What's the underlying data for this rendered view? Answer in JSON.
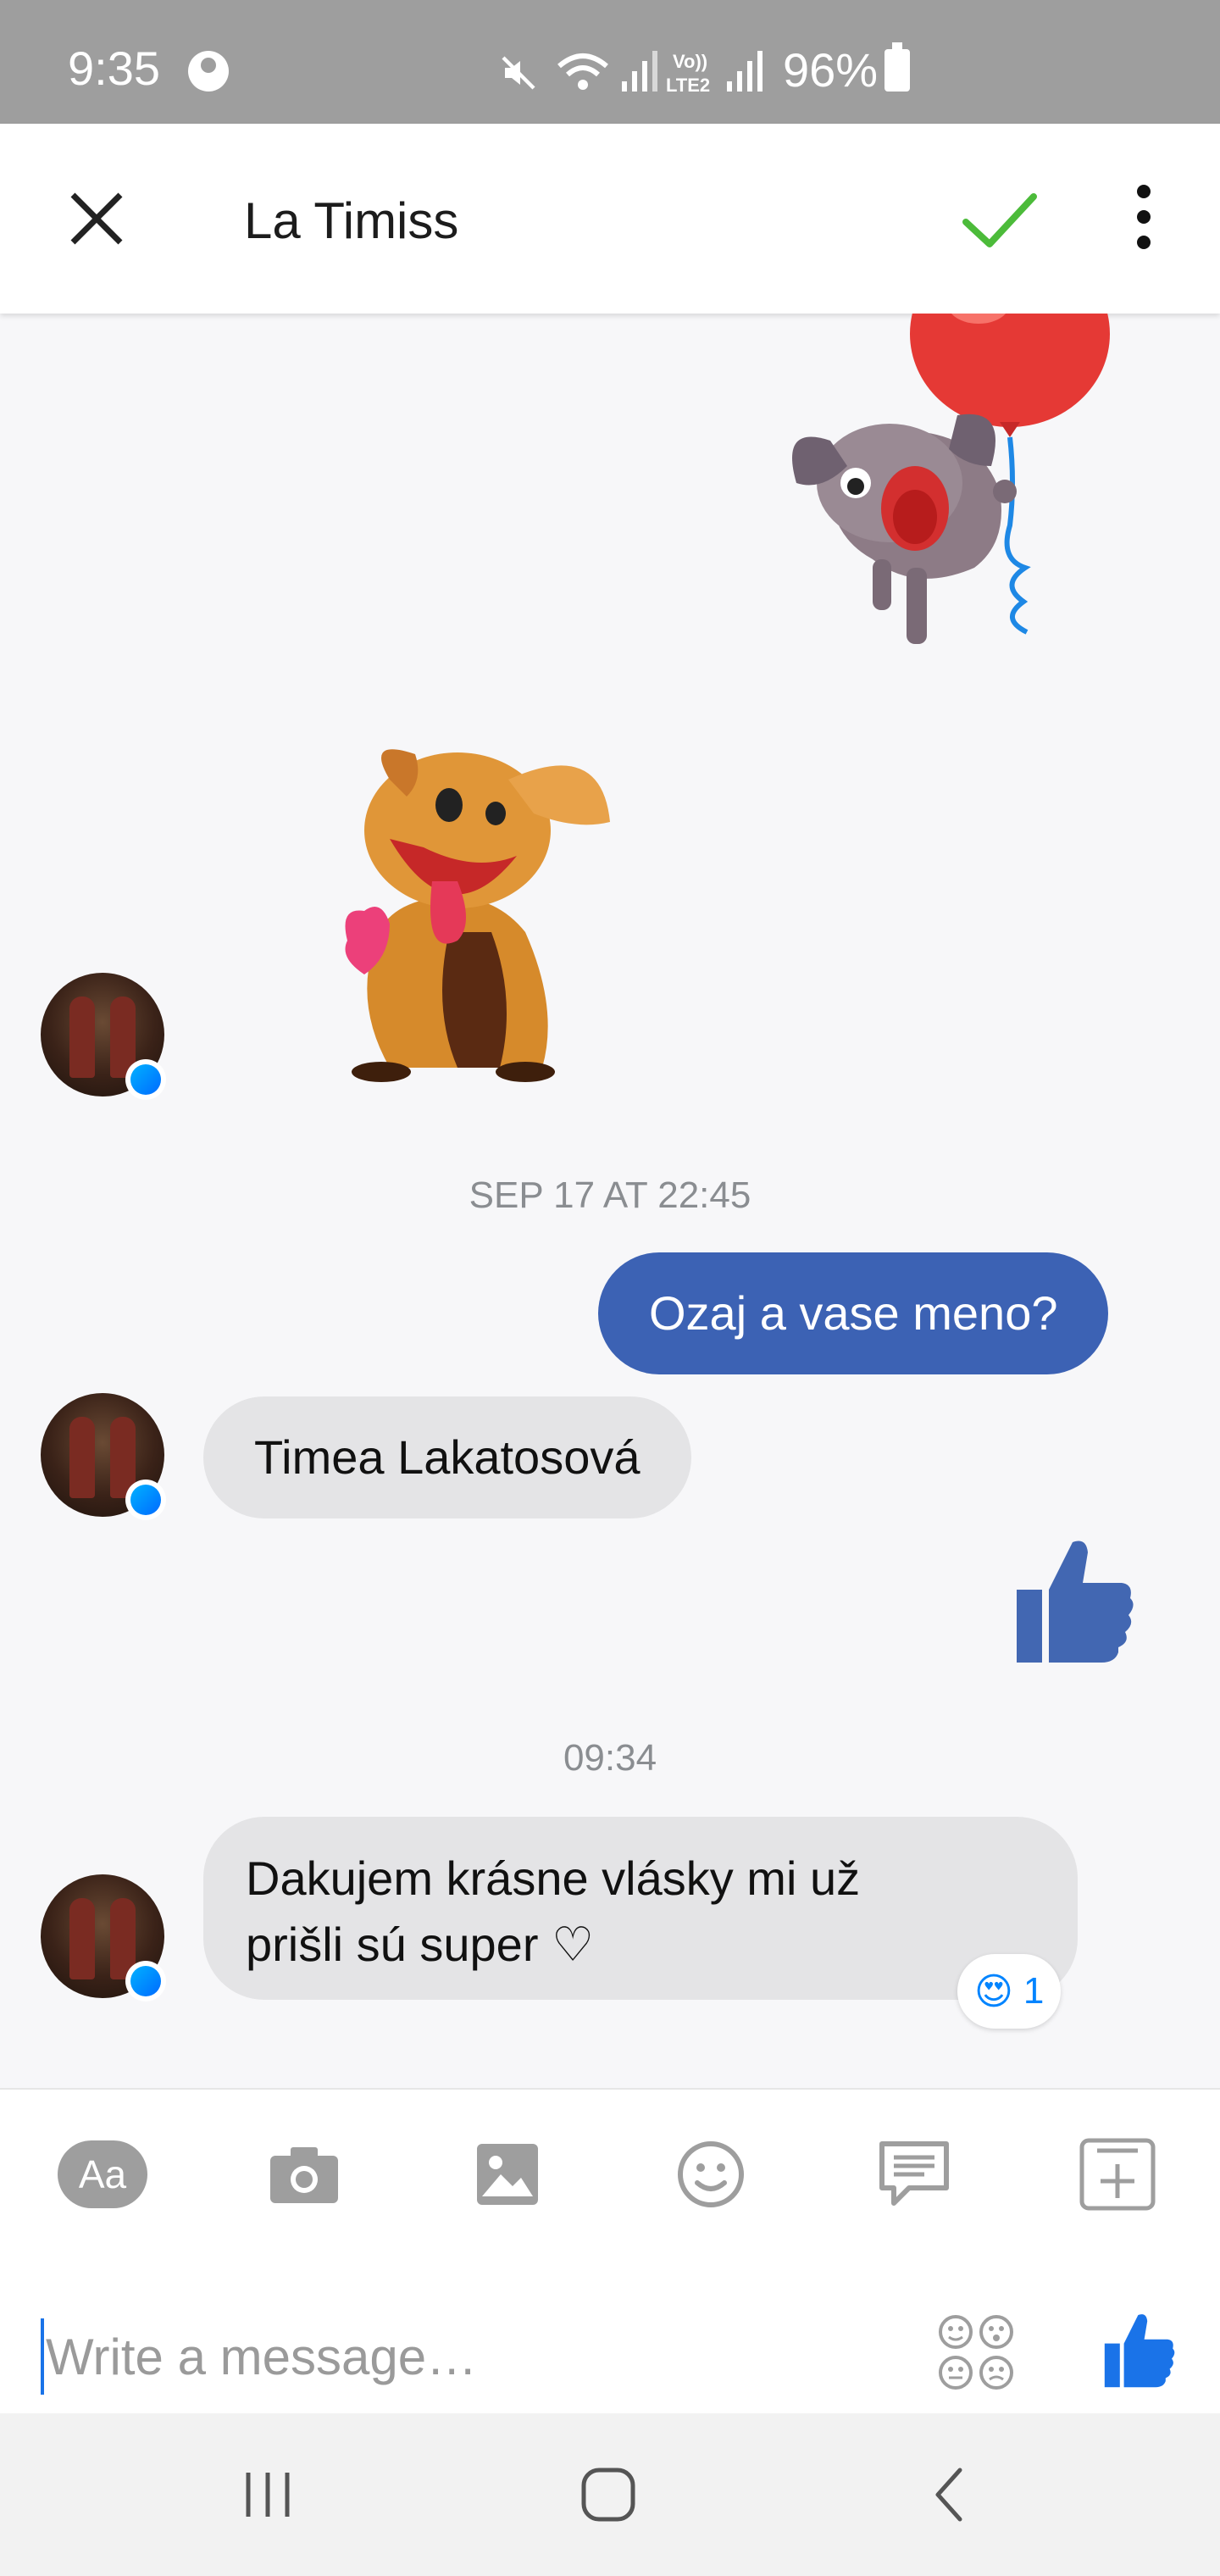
{
  "status_bar": {
    "time": "9:35",
    "battery_percent": "96%",
    "icons": [
      "account-circle-icon",
      "mute-icon",
      "wifi-icon",
      "signal-icon",
      "volte-icon",
      "signal-icon",
      "battery-icon"
    ]
  },
  "header": {
    "title": "La Timiss",
    "close_icon": "close-icon",
    "confirm_icon": "check-icon",
    "menu_icon": "more-vert-icon"
  },
  "conversation": {
    "messages": [
      {
        "type": "sticker",
        "direction": "outgoing",
        "sticker": "dog-with-red-balloon-sticker"
      },
      {
        "type": "sticker",
        "direction": "incoming",
        "sticker": "happy-dog-with-heart-sticker"
      },
      {
        "type": "timestamp",
        "text": "SEP 17 AT 22:45"
      },
      {
        "type": "text",
        "direction": "outgoing",
        "text": "Ozaj a vase meno?"
      },
      {
        "type": "text",
        "direction": "incoming",
        "text": "Timea Lakatosová"
      },
      {
        "type": "like",
        "direction": "outgoing",
        "icon": "thumbs-up-icon"
      },
      {
        "type": "timestamp",
        "text": "09:34"
      },
      {
        "type": "text",
        "direction": "incoming",
        "lines": [
          "Dakujem krásne vlásky mi už",
          "prišli sú super ♡"
        ],
        "reaction": {
          "emoji": "😍",
          "count": "1"
        }
      }
    ]
  },
  "composer": {
    "tools": [
      {
        "name": "text-format",
        "label": "Aa"
      },
      {
        "name": "camera",
        "icon": "camera-icon"
      },
      {
        "name": "gallery",
        "icon": "image-icon"
      },
      {
        "name": "emoji",
        "icon": "smiley-icon"
      },
      {
        "name": "quick-reply",
        "icon": "chat-icon"
      },
      {
        "name": "more",
        "icon": "plus-square-icon"
      }
    ],
    "placeholder": "Write a message…",
    "send_icon": "thumbs-up-icon"
  },
  "colors": {
    "outgoing_bubble": "#3c62b4",
    "incoming_bubble": "#e4e4e6",
    "like_blue": "#4267b2",
    "send_blue": "#1a73e8",
    "check_green": "#4cbb3a"
  }
}
